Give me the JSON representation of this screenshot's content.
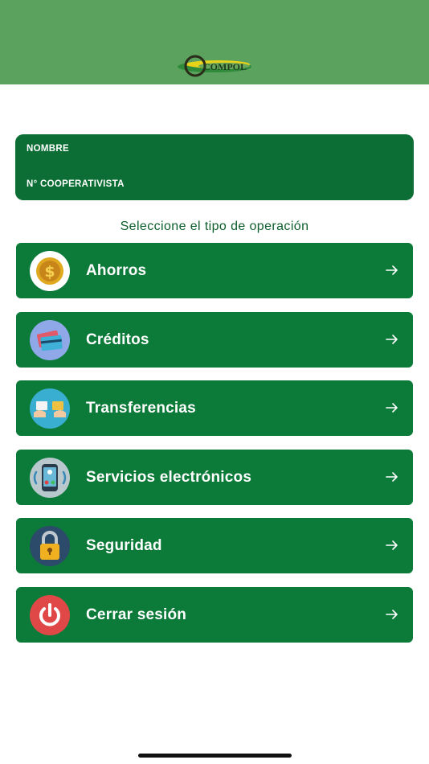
{
  "header": {
    "logo_text": "COMPOL",
    "logo_icon": "compol-logo",
    "background": "#5aa25e"
  },
  "user_card": {
    "name_label": "NOMBRE",
    "coop_label": "N° COOPERATIVISTA"
  },
  "subtitle": "Seleccione el tipo de operación",
  "menu": {
    "items": [
      {
        "label": "Ahorros",
        "icon": "coin-icon"
      },
      {
        "label": "Créditos",
        "icon": "credit-card-icon"
      },
      {
        "label": "Transferencias",
        "icon": "transfer-icon"
      },
      {
        "label": "Servicios electrónicos",
        "icon": "phone-icon"
      },
      {
        "label": "Seguridad",
        "icon": "padlock-icon"
      },
      {
        "label": "Cerrar sesión",
        "icon": "power-icon"
      }
    ],
    "arrow_icon": "arrow-right-icon"
  },
  "colors": {
    "primary_green": "#0c7a38",
    "card_green": "#0c6e34"
  }
}
